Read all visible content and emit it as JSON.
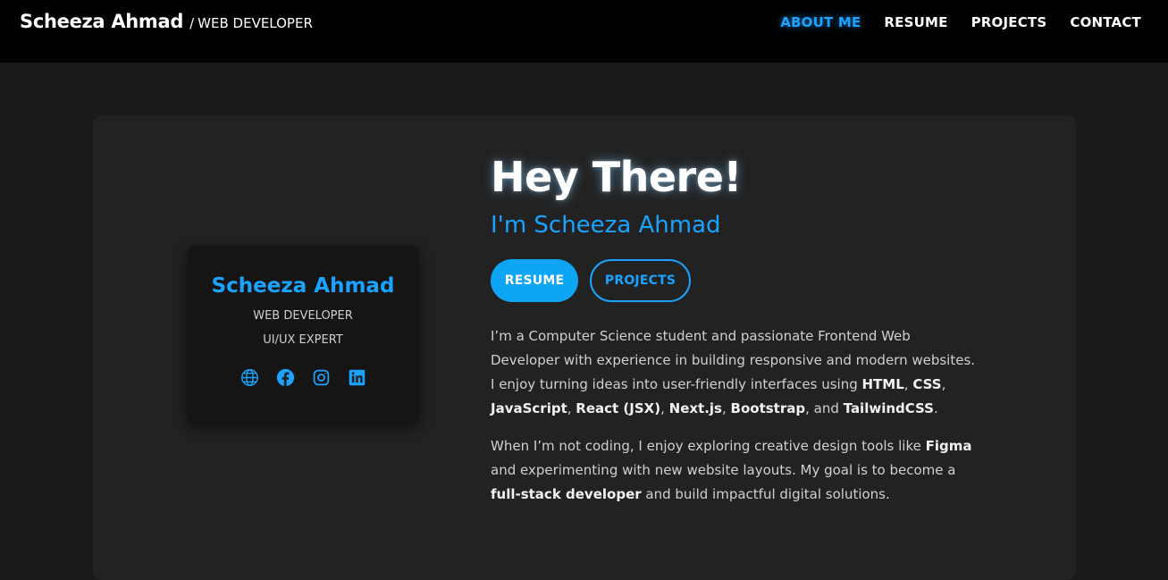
{
  "header": {
    "brand_name": "Scheeza Ahmad",
    "brand_separator": "/",
    "brand_role": "WEB DEVELOPER",
    "nav": [
      {
        "label": "ABOUT ME",
        "active": true
      },
      {
        "label": "RESUME",
        "active": false
      },
      {
        "label": "PROJECTS",
        "active": false
      },
      {
        "label": "CONTACT",
        "active": false
      }
    ]
  },
  "profile_card": {
    "name": "Scheeza Ahmad",
    "role_1": "WEB DEVELOPER",
    "role_2": "UI/UX EXPERT",
    "social_icons": [
      "globe-icon",
      "facebook-icon",
      "instagram-icon",
      "linkedin-icon"
    ]
  },
  "hero": {
    "title": "Hey There!",
    "subtitle": "I'm Scheeza Ahmad",
    "resume_button": "RESUME",
    "projects_button": "PROJECTS"
  },
  "about": {
    "p1": {
      "intro": "I’m a Computer Science student and passionate Frontend Web Developer with experience in building responsive and modern websites. I enjoy turning ideas into user-friendly interfaces using ",
      "skill_html": "HTML",
      "sep1": ", ",
      "skill_css": "CSS",
      "sep2": ", ",
      "skill_js": "JavaScript",
      "sep3": ", ",
      "skill_react": "React (JSX)",
      "sep4": ", ",
      "skill_next": "Next.js",
      "sep5": ", ",
      "skill_bootstrap": "Bootstrap",
      "sep6": ", and ",
      "skill_tailwind": "TailwindCSS",
      "end": "."
    },
    "p2": {
      "intro": "When I’m not coding, I enjoy exploring creative design tools like ",
      "tool": "Figma",
      "middle": " and experimenting with new website layouts. My goal is to become a ",
      "goal": "full-stack developer",
      "end": " and build impactful digital solutions."
    }
  },
  "colors": {
    "accent": "#1aa3ff",
    "header_bg": "#000000",
    "page_bg": "#1b1b1b",
    "panel_bg": "#222222",
    "card_bg": "#151515"
  }
}
